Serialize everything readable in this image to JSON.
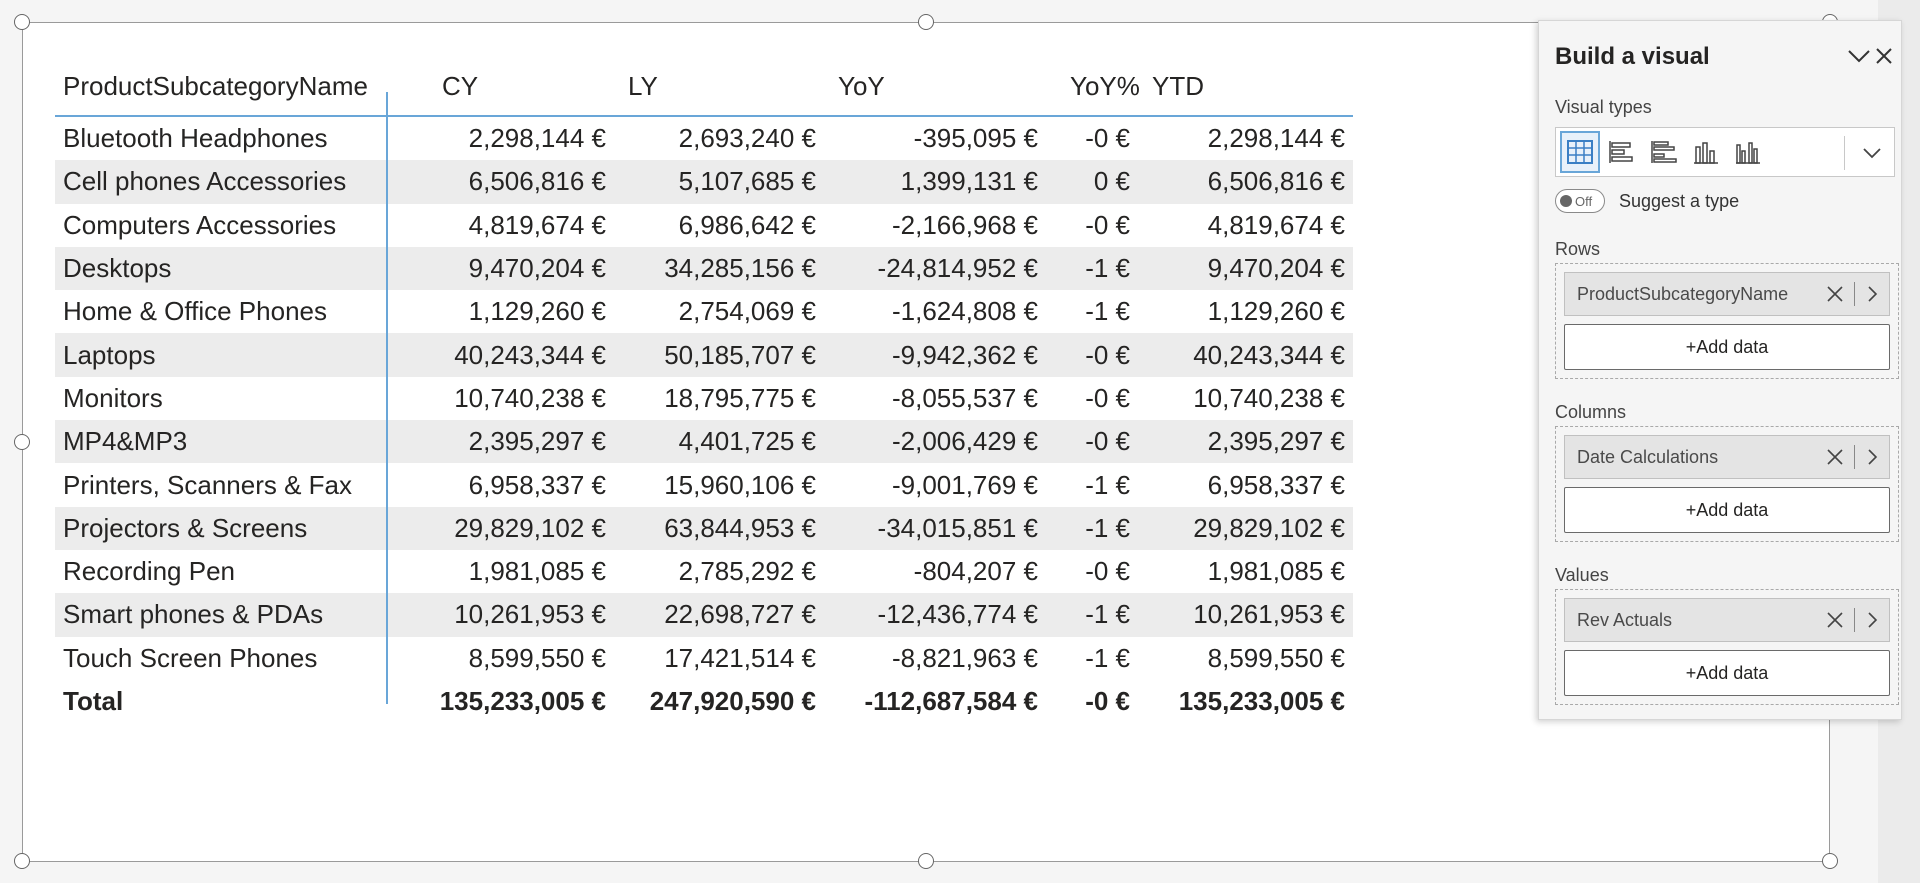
{
  "table": {
    "columns": [
      "ProductSubcategoryName",
      "CY",
      "LY",
      "YoY",
      "YoY%",
      "YTD"
    ],
    "rows": [
      [
        "Bluetooth Headphones",
        "2,298,144 €",
        "2,693,240 €",
        "-395,095 €",
        "-0 €",
        "2,298,144 €"
      ],
      [
        "Cell phones Accessories",
        "6,506,816 €",
        "5,107,685 €",
        "1,399,131 €",
        "0 €",
        "6,506,816 €"
      ],
      [
        "Computers Accessories",
        "4,819,674 €",
        "6,986,642 €",
        "-2,166,968 €",
        "-0 €",
        "4,819,674 €"
      ],
      [
        "Desktops",
        "9,470,204 €",
        "34,285,156 €",
        "-24,814,952 €",
        "-1 €",
        "9,470,204 €"
      ],
      [
        "Home & Office Phones",
        "1,129,260 €",
        "2,754,069 €",
        "-1,624,808 €",
        "-1 €",
        "1,129,260 €"
      ],
      [
        "Laptops",
        "40,243,344 €",
        "50,185,707 €",
        "-9,942,362 €",
        "-0 €",
        "40,243,344 €"
      ],
      [
        "Monitors",
        "10,740,238 €",
        "18,795,775 €",
        "-8,055,537 €",
        "-0 €",
        "10,740,238 €"
      ],
      [
        "MP4&MP3",
        "2,395,297 €",
        "4,401,725 €",
        "-2,006,429 €",
        "-0 €",
        "2,395,297 €"
      ],
      [
        "Printers, Scanners & Fax",
        "6,958,337 €",
        "15,960,106 €",
        "-9,001,769 €",
        "-1 €",
        "6,958,337 €"
      ],
      [
        "Projectors & Screens",
        "29,829,102 €",
        "63,844,953 €",
        "-34,015,851 €",
        "-1 €",
        "29,829,102 €"
      ],
      [
        "Recording Pen",
        "1,981,085 €",
        "2,785,292 €",
        "-804,207 €",
        "-0 €",
        "1,981,085 €"
      ],
      [
        "Smart phones & PDAs",
        "10,261,953 €",
        "22,698,727 €",
        "-12,436,774 €",
        "-1 €",
        "10,261,953 €"
      ],
      [
        "Touch Screen Phones",
        "8,599,550 €",
        "17,421,514 €",
        "-8,821,963 €",
        "-1 €",
        "8,599,550 €"
      ]
    ],
    "total": [
      "Total",
      "135,233,005 €",
      "247,920,590 €",
      "-112,687,584 €",
      "-0 €",
      "135,233,005 €"
    ]
  },
  "pane": {
    "title": "Build a visual",
    "visual_types_label": "Visual types",
    "suggest_toggle_state": "Off",
    "suggest_label": "Suggest a type",
    "rows_label": "Rows",
    "rows_field": "ProductSubcategoryName",
    "columns_label": "Columns",
    "columns_field": "Date Calculations",
    "values_label": "Values",
    "values_field": "Rev Actuals",
    "add_data_label": "+Add data"
  },
  "colors": {
    "accent": "#69a6d8",
    "row_shade": "#ececec",
    "text": "#252423"
  },
  "icons": {
    "visual_header": [
      "filter-icon",
      "format-brush-icon",
      "focus-mode-icon",
      "more-options-icon"
    ],
    "visual_types": [
      "table-icon",
      "stacked-bar-icon",
      "clustered-bar-icon",
      "stacked-column-icon",
      "clustered-column-icon"
    ]
  }
}
